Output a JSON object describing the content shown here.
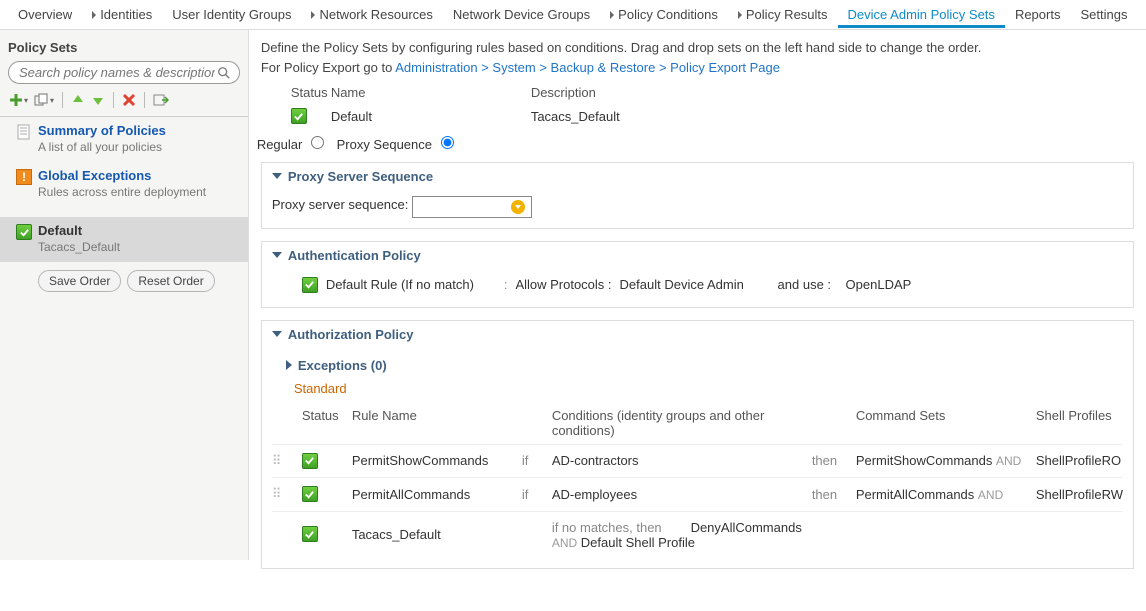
{
  "nav": {
    "items": [
      {
        "label": "Overview",
        "caret": false
      },
      {
        "label": "Identities",
        "caret": true
      },
      {
        "label": "User Identity Groups",
        "caret": false
      },
      {
        "label": "Network Resources",
        "caret": true
      },
      {
        "label": "Network Device Groups",
        "caret": false
      },
      {
        "label": "Policy Conditions",
        "caret": true
      },
      {
        "label": "Policy Results",
        "caret": true
      },
      {
        "label": "Device Admin Policy Sets",
        "caret": false,
        "active": true
      },
      {
        "label": "Reports",
        "caret": false
      },
      {
        "label": "Settings",
        "caret": false
      }
    ]
  },
  "sidebar": {
    "header": "Policy Sets",
    "search_placeholder": "Search policy names & descriptions.",
    "summary": {
      "title": "Summary of Policies",
      "sub": "A list of all your policies"
    },
    "global": {
      "title": "Global Exceptions",
      "sub": "Rules across entire deployment"
    },
    "default": {
      "title": "Default",
      "sub": "Tacacs_Default"
    },
    "save_btn": "Save Order",
    "reset_btn": "Reset Order"
  },
  "content": {
    "desc_line1": "Define the Policy Sets by configuring rules based on conditions. Drag and drop sets on the left hand side to change the order.",
    "desc_line2_prefix": "For Policy Export go to ",
    "desc_link": "Administration > System > Backup & Restore > Policy Export Page",
    "table_headers": {
      "status": "Status",
      "name": "Name",
      "desc": "Description"
    },
    "row": {
      "name": "Default",
      "desc": "Tacacs_Default"
    },
    "radio": {
      "regular": "Regular",
      "proxy": "Proxy Sequence"
    },
    "proxy_panel": {
      "title": "Proxy Server Sequence",
      "label": "Proxy server sequence:"
    },
    "authn_panel": {
      "title": "Authentication Policy",
      "rule": "Default Rule (If no match)",
      "colon": ":",
      "allow": "Allow Protocols :",
      "proto": "Default Device Admin",
      "anduse": "and use :",
      "store": "OpenLDAP"
    },
    "authz_panel": {
      "title": "Authorization Policy",
      "exceptions": "Exceptions (0)",
      "standard": "Standard",
      "headers": {
        "status": "Status",
        "rule": "Rule Name",
        "cond": "Conditions (identity groups and other conditions)",
        "cmd": "Command Sets",
        "shell": "Shell Profiles"
      },
      "if": "if",
      "then": "then",
      "and": "AND",
      "rows": [
        {
          "name": "PermitShowCommands",
          "cond": "AD-contractors",
          "cmd": "PermitShowCommands",
          "shell": "ShellProfileRO",
          "drag": true
        },
        {
          "name": "PermitAllCommands",
          "cond": "AD-employees",
          "cmd": "PermitAllCommands",
          "shell": "ShellProfileRW",
          "drag": true
        }
      ],
      "default_row": {
        "name": "Tacacs_Default",
        "cond_label": "if no matches, then",
        "cmd": "DenyAllCommands",
        "shell": "Default Shell Profile"
      }
    }
  }
}
